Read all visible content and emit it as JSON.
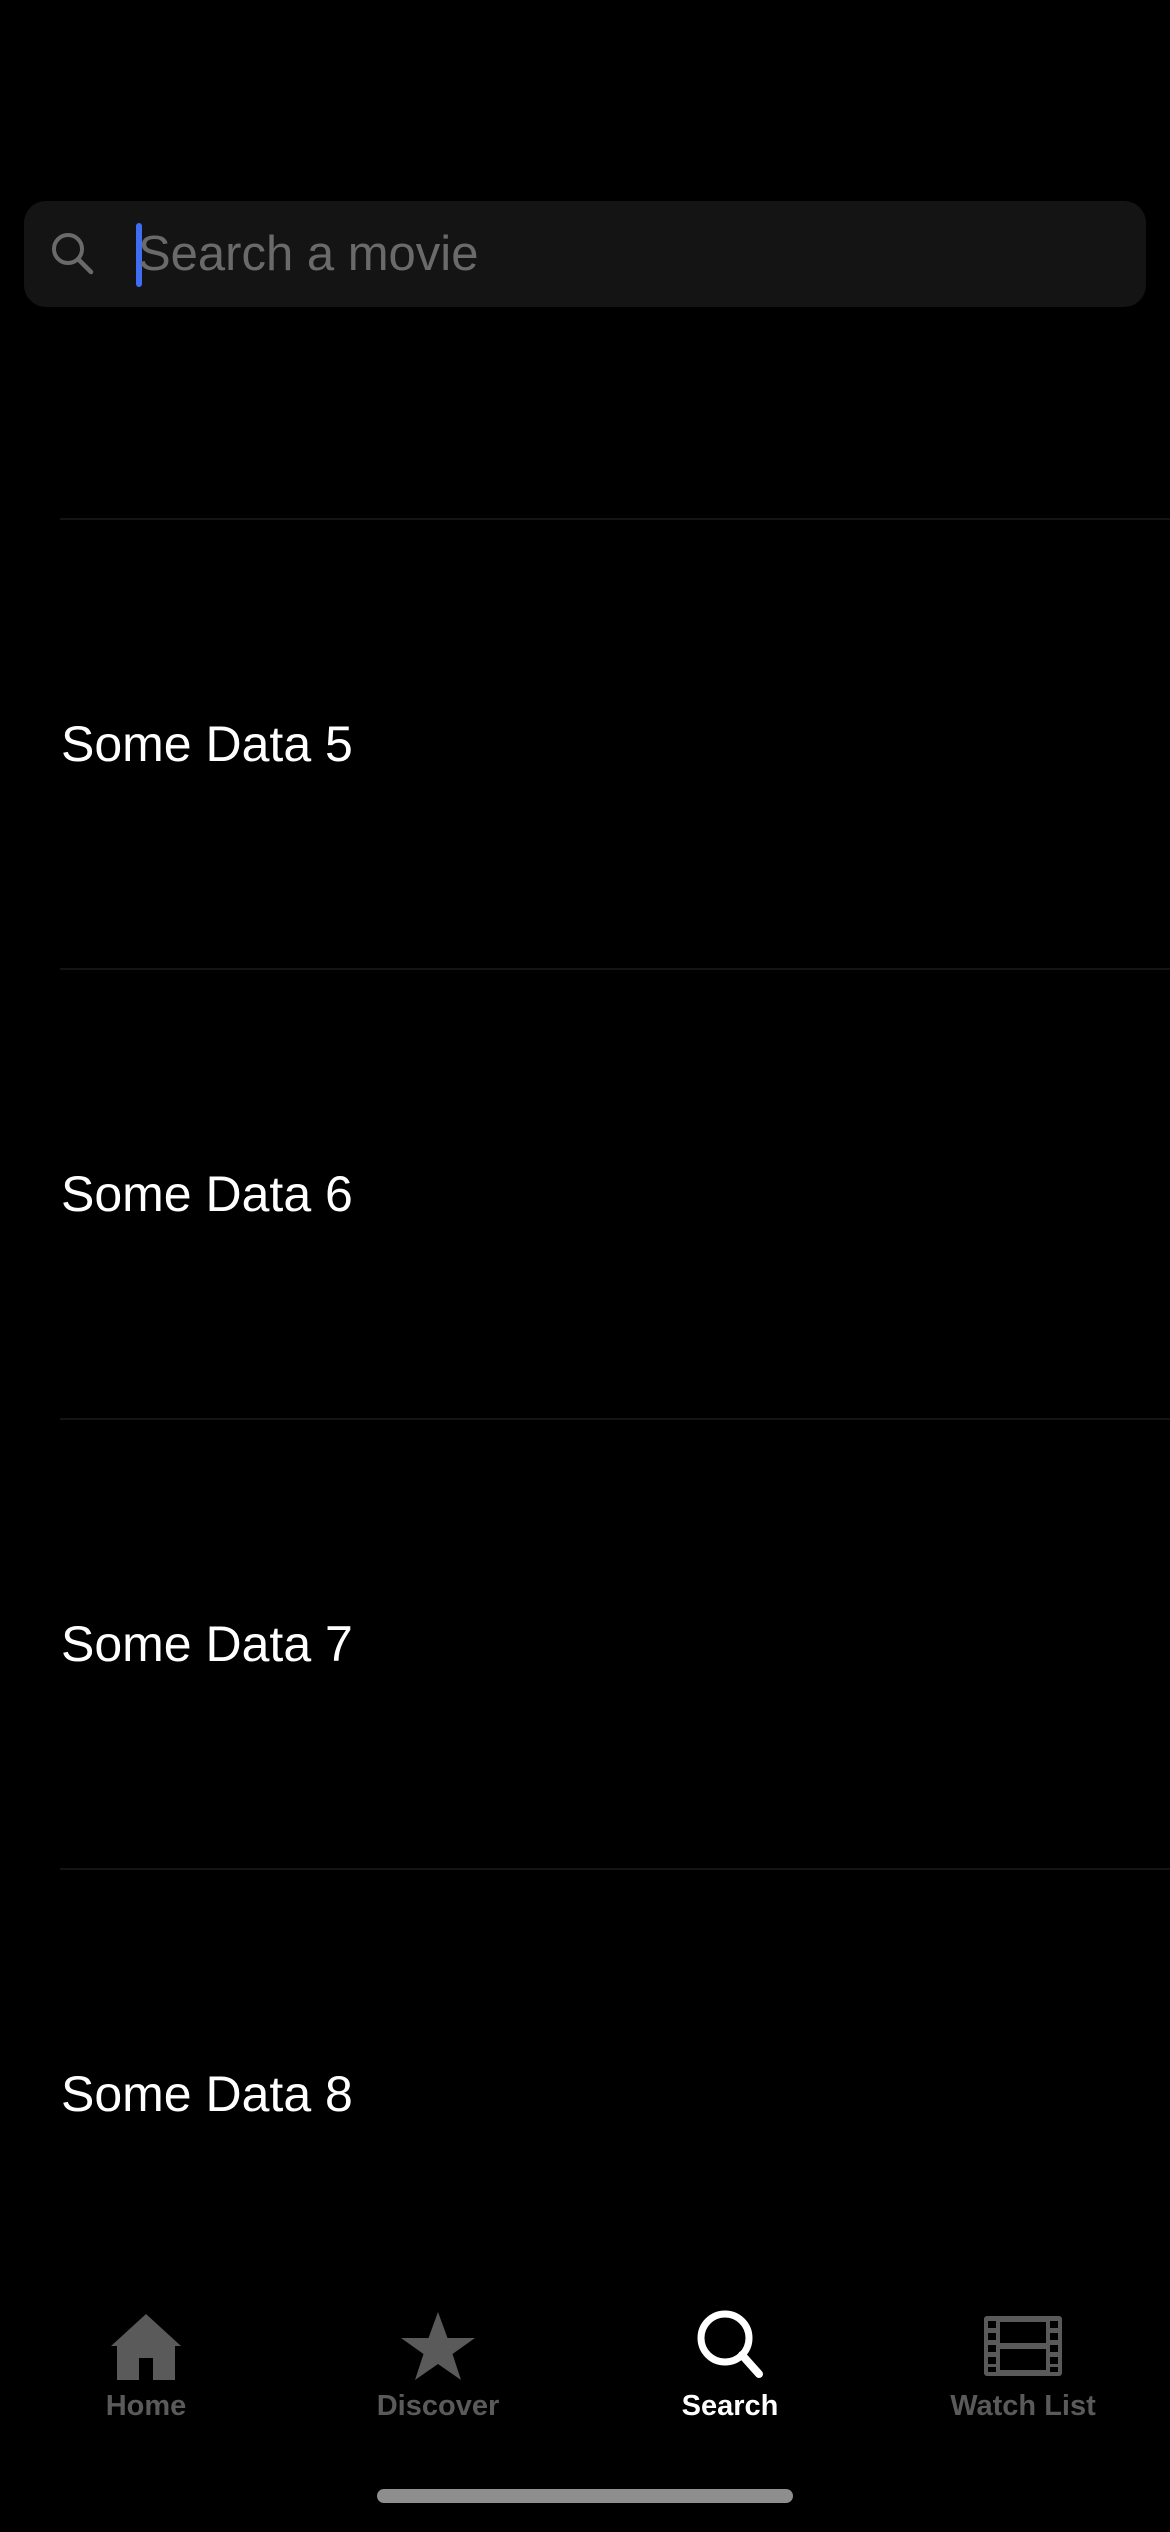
{
  "search": {
    "placeholder": "Search a movie",
    "value": ""
  },
  "results": [
    {
      "label": "Some Data 5"
    },
    {
      "label": "Some Data 6"
    },
    {
      "label": "Some Data 7"
    },
    {
      "label": "Some Data 8"
    }
  ],
  "tabbar": {
    "tabs": [
      {
        "label": "Home",
        "icon": "house-icon",
        "active": false
      },
      {
        "label": "Discover",
        "icon": "star-icon",
        "active": false
      },
      {
        "label": "Search",
        "icon": "magnifying-glass-icon",
        "active": true
      },
      {
        "label": "Watch List",
        "icon": "film-icon",
        "active": false
      }
    ]
  },
  "colors": {
    "background": "#000000",
    "search_field": "#141414",
    "caret": "#3f6ef5",
    "tab_active": "#ffffff",
    "tab_inactive": "#5a5a5a"
  }
}
